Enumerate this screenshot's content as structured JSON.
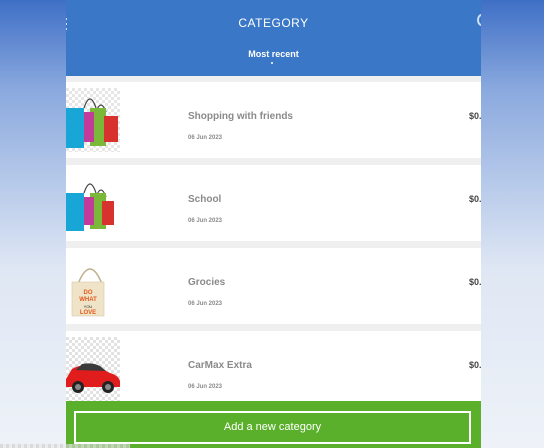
{
  "header": {
    "title": "CATEGORY",
    "subtitle": "Most recent"
  },
  "categories": [
    {
      "name": "Shopping with friends",
      "date": "06 Jun 2023",
      "amount": "$0.",
      "icon": "shopping-bags-icon"
    },
    {
      "name": "School",
      "date": "06 Jun 2023",
      "amount": "$0.",
      "icon": "shopping-bags-icon"
    },
    {
      "name": "Grocies",
      "date": "06 Jun 2023",
      "amount": "$0.",
      "icon": "tote-bag-icon"
    },
    {
      "name": "CarMax Extra",
      "date": "06 Jun 2023",
      "amount": "$0.",
      "icon": "car-icon"
    }
  ],
  "footer": {
    "add_label": "Add a new category"
  },
  "colors": {
    "header": "#3a78c7",
    "footer": "#5bb02b",
    "text_muted": "#8a8a8a"
  }
}
